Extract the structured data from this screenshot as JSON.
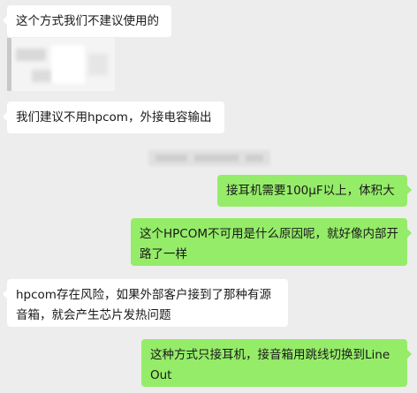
{
  "messages": [
    {
      "side": "left",
      "text": "这个方式我们不建议使用的"
    },
    {
      "side": "left",
      "text": "我们建议不用hpcom，外接电容输出"
    },
    {
      "side": "right",
      "text": "接耳机需要100μF以上，体积大"
    },
    {
      "side": "right",
      "text": "这个HPCOM不可用是什么原因呢，就好像内部开路了一样"
    },
    {
      "side": "left",
      "text": "hpcom存在风险，如果外部客户接到了那种有源音箱，就会产生芯片发热问题"
    },
    {
      "side": "right",
      "text": "这种方式只接耳机，接音箱用跳线切换到Line Out"
    }
  ],
  "colors": {
    "background": "#ededed",
    "incoming_bubble": "#ffffff",
    "outgoing_bubble": "#95ec69"
  }
}
